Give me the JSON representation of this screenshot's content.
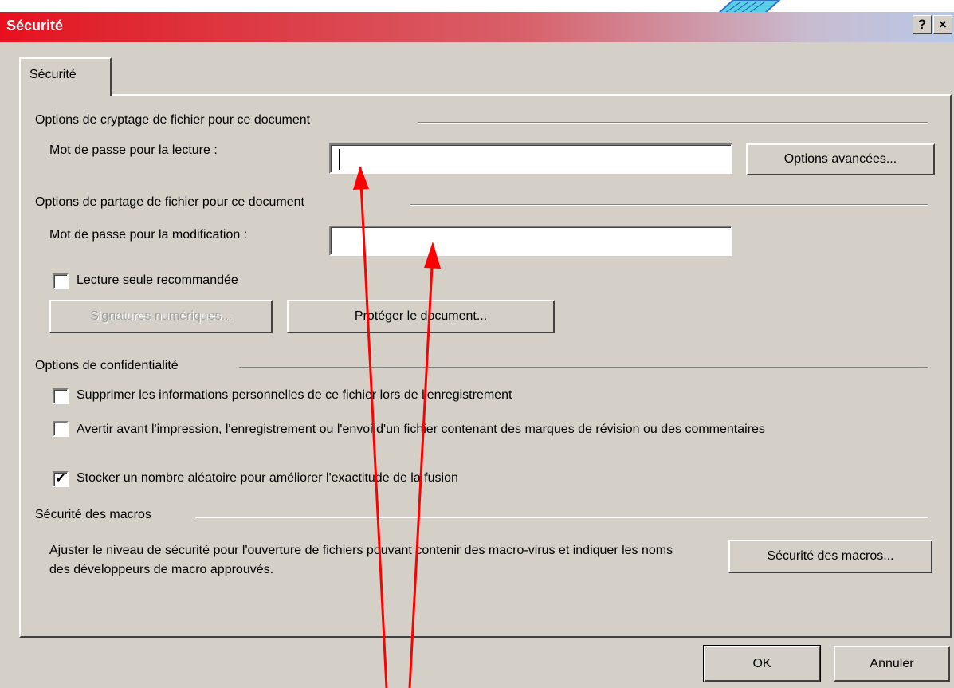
{
  "dialog": {
    "title": "Sécurité",
    "help_label": "?",
    "close_label": "×"
  },
  "tabs": [
    {
      "label": "Sécurité"
    }
  ],
  "encryption": {
    "group_title": "Options de cryptage de fichier pour ce document",
    "read_password_label": "Mot de passe pour la lecture :",
    "read_password_value": "",
    "advanced_button": "Options avancées..."
  },
  "sharing": {
    "group_title": "Options de partage de fichier pour ce document",
    "modify_password_label": "Mot de passe pour la modification :",
    "modify_password_value": "",
    "readonly_label": "Lecture seule recommandée",
    "readonly_checked": false,
    "signatures_button": "Signatures numériques...",
    "protect_button": "Protéger le document..."
  },
  "privacy": {
    "group_title": "Options de confidentialité",
    "options": [
      {
        "label": "Supprimer les informations personnelles de ce fichier lors de l'enregistrement",
        "checked": false
      },
      {
        "label": "Avertir avant l'impression, l'enregistrement ou l'envoi d'un fichier contenant des marques de révision ou des commentaires",
        "checked": false
      },
      {
        "label": "Stocker un nombre aléatoire pour améliorer l'exactitude de la fusion",
        "checked": true
      }
    ]
  },
  "macros": {
    "group_title": "Sécurité des macros",
    "description": "Ajuster le niveau de sécurité pour l'ouverture de fichiers pouvant contenir des macro-virus et indiquer les noms des développeurs de macro approuvés.",
    "button": "Sécurité des macros..."
  },
  "footer": {
    "ok": "OK",
    "cancel": "Annuler"
  },
  "annotation": {
    "color": "#ff0000"
  }
}
